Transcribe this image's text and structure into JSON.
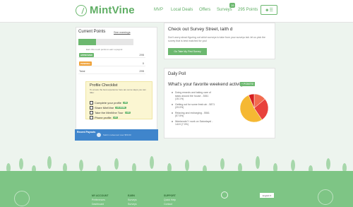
{
  "header": {
    "logo": "MintVine",
    "nav": {
      "mvp": "MVP",
      "local_deals": "Local Deals",
      "offers": "Offers",
      "surveys": "Surveys",
      "points": "295 Points"
    },
    "survey_badge": "19"
  },
  "current_points": {
    "title": "Current Points",
    "see_earnings": "See earnings",
    "progress_percent": 32,
    "note": "Earn this much points to earn a payout",
    "rows": [
      {
        "tag": "APPROVED",
        "value": "295"
      },
      {
        "tag": "PENDING",
        "value": "0"
      },
      {
        "label": "Total",
        "value": "295"
      }
    ]
  },
  "checklist": {
    "title": "Profile Checklist",
    "desc": "To ensure the best experience here are some steps you can take:",
    "items": [
      {
        "label": "Complete your profile",
        "badge": "+50"
      },
      {
        "label": "Share MintVine",
        "badge": "+20 MORE"
      },
      {
        "label": "Take the MintVine Tour",
        "badge": "+100"
      },
      {
        "label": "Phone profile",
        "badge": "+20"
      }
    ]
  },
  "payouts": {
    "label": "Recent Payouts",
    "text": "Sabrin redeemed over $50.00"
  },
  "survey_street": {
    "title": "Check out Survey Street, laith d",
    "desc": "Don't worry about figuring out which surveys to take from your surveys tab. let us pick the survey that is best matched for you!",
    "button": "Go Take My First Survey"
  },
  "daily_poll": {
    "title": "Daily Poll",
    "question": "What's your favorite weekend activity?",
    "badge": "+ POINTS!",
    "options": [
      "Doing errands and taking care of tasks around the house - 3061 (15.1%)",
      "Getting out for some fresh air - 5871 (29.0%)",
      "Relaxing and recharging - 5561 (57.5%)",
      "Weekends? I work on Saturdays! - 1419 (7.0%)"
    ]
  },
  "chart_data": {
    "type": "pie",
    "categories": [
      "Doing errands and taking care of tasks around the house",
      "Getting out for some fresh air",
      "Relaxing and recharging",
      "Weekends? I work on Saturdays!"
    ],
    "values": [
      15.1,
      29.0,
      57.5,
      7.0
    ],
    "colors": [
      "#f26b4f",
      "#e8413b",
      "#f5b833",
      "#d61f1f"
    ]
  },
  "footer": {
    "col1": {
      "title": "MY ACCOUNT",
      "links": [
        "Preferences",
        "Dashboard"
      ]
    },
    "col2": {
      "title": "EARN",
      "links": [
        "Surveys",
        "Surveys"
      ]
    },
    "col3": {
      "title": "SUPPORT",
      "links": [
        "Quick Help",
        "Contact"
      ]
    },
    "language": "English"
  }
}
